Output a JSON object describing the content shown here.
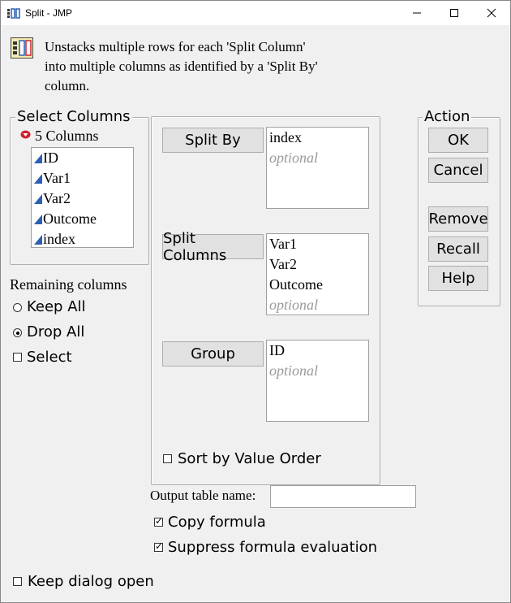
{
  "window": {
    "title": "Split - JMP",
    "min_icon": "minimize-icon",
    "max_icon": "maximize-icon",
    "close_icon": "close-icon"
  },
  "description": {
    "line1": "Unstacks multiple rows for each 'Split Column'",
    "line2": "into multiple columns as identified by a 'Split By'",
    "line3": "column."
  },
  "select_columns": {
    "legend": "Select Columns",
    "count_label": "5 Columns",
    "items": [
      "ID",
      "Var1",
      "Var2",
      "Outcome",
      "index"
    ]
  },
  "remaining": {
    "heading": "Remaining columns",
    "options": [
      "Keep All",
      "Drop All",
      "Select"
    ],
    "selected": "Drop All"
  },
  "roles": {
    "split_by": {
      "label": "Split By",
      "items": [
        "index"
      ],
      "placeholder": "optional"
    },
    "split_columns": {
      "label": "Split Columns",
      "items": [
        "Var1",
        "Var2",
        "Outcome"
      ],
      "placeholder": "optional"
    },
    "group": {
      "label": "Group",
      "items": [
        "ID"
      ],
      "placeholder": "optional"
    }
  },
  "sort_by_value": {
    "label": "Sort by Value Order",
    "checked": false
  },
  "action": {
    "legend": "Action",
    "ok": "OK",
    "cancel": "Cancel",
    "remove": "Remove",
    "recall": "Recall",
    "help": "Help"
  },
  "output": {
    "label": "Output table name:",
    "value": ""
  },
  "copy_formula": {
    "label": "Copy formula",
    "checked": true
  },
  "suppress_eval": {
    "label": "Suppress formula evaluation",
    "checked": true
  },
  "keep_open": {
    "label": "Keep dialog open",
    "checked": false
  },
  "colors": {
    "accent_blue": "#2b5fb4",
    "red_disclosure": "#d0202a"
  }
}
